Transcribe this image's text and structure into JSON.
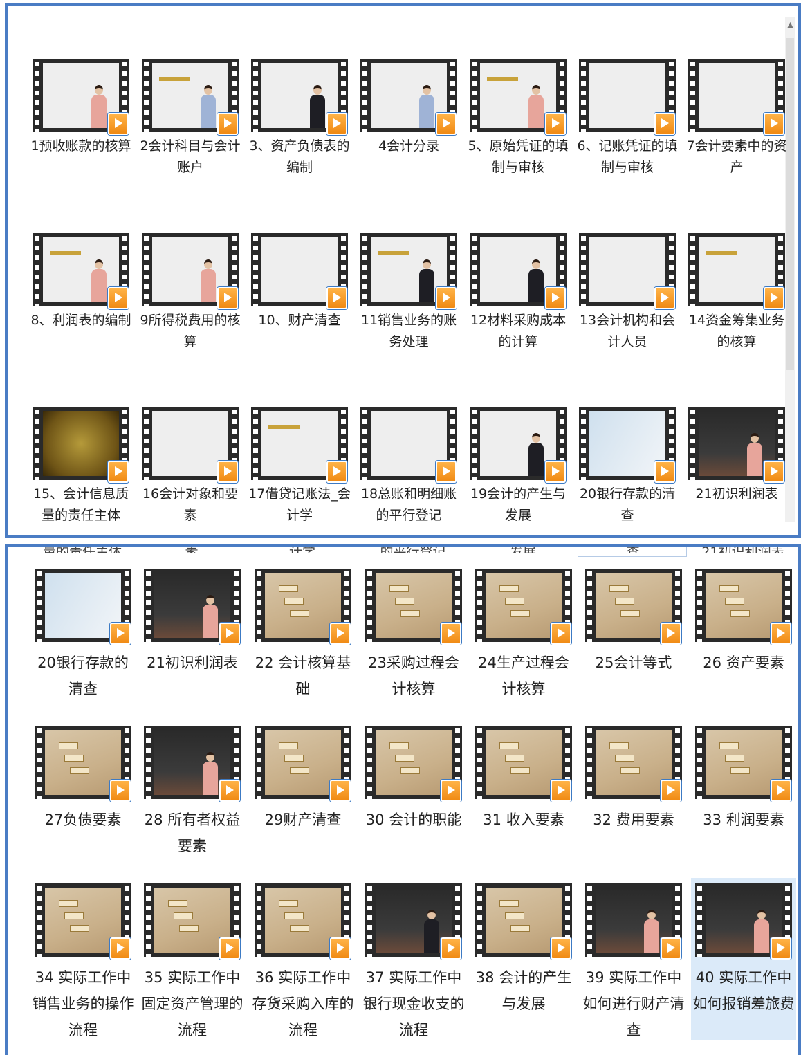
{
  "colors": {
    "border": "#4a7cc4",
    "play_icon": "#f08a14",
    "selected": "#dbeaf9"
  },
  "panel1": {
    "videos": [
      {
        "label": "1预收账款的核算",
        "bg": "light",
        "person": "pink"
      },
      {
        "label": "2会计科目与会计账户",
        "bg": "light",
        "person": "blue"
      },
      {
        "label": "3、资产负债表的编制",
        "bg": "light",
        "person": "dark"
      },
      {
        "label": "4会计分录",
        "bg": "light",
        "person": "blue"
      },
      {
        "label": "5、原始凭证的填制与审核",
        "bg": "light",
        "person": "pink"
      },
      {
        "label": "6、记账凭证的填制与审核",
        "bg": "light",
        "person": ""
      },
      {
        "label": "7会计要素中的资产",
        "bg": "light",
        "person": ""
      },
      {
        "label": "8、利润表的编制",
        "bg": "light",
        "person": "pink"
      },
      {
        "label": "9所得税费用的核算",
        "bg": "light",
        "person": "pink"
      },
      {
        "label": "10、财产清查",
        "bg": "light",
        "person": ""
      },
      {
        "label": "11销售业务的账务处理",
        "bg": "light",
        "person": "dark"
      },
      {
        "label": "12材料采购成本的计算",
        "bg": "light",
        "person": "dark"
      },
      {
        "label": "13会计机构和会计人员",
        "bg": "light",
        "person": ""
      },
      {
        "label": "14资金筹集业务的核算",
        "bg": "light",
        "person": ""
      },
      {
        "label": "15、会计信息质量的责任主体",
        "bg": "gold",
        "person": ""
      },
      {
        "label": "16会计对象和要素",
        "bg": "light",
        "person": ""
      },
      {
        "label": "17借贷记账法_会计学",
        "bg": "light",
        "person": ""
      },
      {
        "label": "18总账和明细账的平行登记",
        "bg": "light",
        "person": ""
      },
      {
        "label": "19会计的产生与发展",
        "bg": "light",
        "person": "dark"
      },
      {
        "label": "20银行存款的清查",
        "bg": "pale",
        "person": ""
      },
      {
        "label": "21初识利润表",
        "bg": "dark",
        "person": "pink"
      }
    ]
  },
  "panel2": {
    "cut_labels": [
      "量的责任主体",
      "素",
      "计学",
      "的平行登记",
      "发展",
      "查",
      "21初识利润表"
    ],
    "videos": [
      {
        "label": "20银行存款的清查",
        "bg": "pale",
        "person": ""
      },
      {
        "label": "21初识利润表",
        "bg": "dark",
        "person": "pink"
      },
      {
        "label": "22 会计核算基础",
        "bg": "beige",
        "person": ""
      },
      {
        "label": "23采购过程会计核算",
        "bg": "beige",
        "person": ""
      },
      {
        "label": "24生产过程会计核算",
        "bg": "beige",
        "person": ""
      },
      {
        "label": "25会计等式",
        "bg": "beige",
        "person": ""
      },
      {
        "label": "26 资产要素",
        "bg": "beige",
        "person": ""
      },
      {
        "label": "27负债要素",
        "bg": "beige",
        "person": ""
      },
      {
        "label": "28 所有者权益要素",
        "bg": "dark",
        "person": "pink"
      },
      {
        "label": "29财产清查",
        "bg": "beige",
        "person": ""
      },
      {
        "label": "30 会计的职能",
        "bg": "beige",
        "person": ""
      },
      {
        "label": "31 收入要素",
        "bg": "beige",
        "person": ""
      },
      {
        "label": "32 费用要素",
        "bg": "beige",
        "person": ""
      },
      {
        "label": "33 利润要素",
        "bg": "beige",
        "person": ""
      },
      {
        "label": "34 实际工作中销售业务的操作流程",
        "bg": "beige",
        "person": ""
      },
      {
        "label": "35 实际工作中固定资产管理的流程",
        "bg": "beige",
        "person": ""
      },
      {
        "label": "36 实际工作中存货采购入库的流程",
        "bg": "beige",
        "person": ""
      },
      {
        "label": "37 实际工作中银行现金收支的流程",
        "bg": "dark",
        "person": "dark"
      },
      {
        "label": "38 会计的产生与发展",
        "bg": "beige",
        "person": ""
      },
      {
        "label": "39 实际工作中如何进行财产清查",
        "bg": "dark",
        "person": "pink"
      },
      {
        "label": "40 实际工作中如何报销差旅费",
        "bg": "dark",
        "person": "pink",
        "selected": true
      }
    ]
  }
}
